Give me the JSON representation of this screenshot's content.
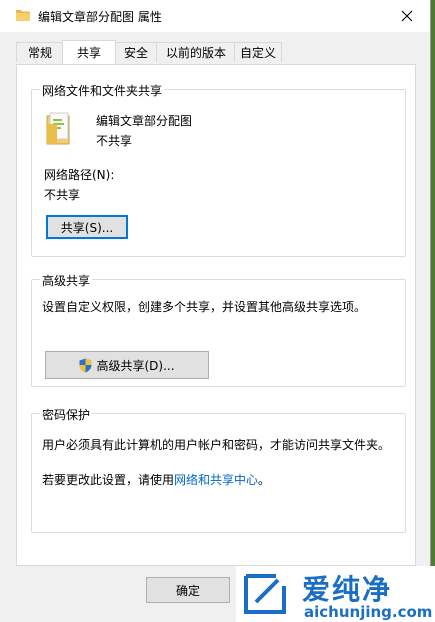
{
  "window": {
    "title": "编辑文章部分配图 属性"
  },
  "tabs": [
    {
      "label": "常规",
      "active": false
    },
    {
      "label": "共享",
      "active": true
    },
    {
      "label": "安全",
      "active": false
    },
    {
      "label": "以前的版本",
      "active": false
    },
    {
      "label": "自定义",
      "active": false
    }
  ],
  "network_sharing": {
    "group_title": "网络文件和文件夹共享",
    "folder_name": "编辑文章部分配图",
    "share_status": "不共享",
    "path_label": "网络路径(N):",
    "path_value": "不共享",
    "share_button": "共享(S)..."
  },
  "advanced_sharing": {
    "group_title": "高级共享",
    "description": "设置自定义权限，创建多个共享，并设置其他高级共享选项。",
    "button": "高级共享(D)..."
  },
  "password_protection": {
    "group_title": "密码保护",
    "description": "用户必须具有此计算机的用户帐户和密码，才能访问共享文件夹。",
    "change_prefix": "若要更改此设置，请使用",
    "change_link": "网络和共享中心",
    "change_suffix": "。"
  },
  "footer": {
    "ok_button": "确定"
  },
  "watermark": {
    "brand_cn": "爱纯净",
    "brand_url": "aichunjing.com"
  },
  "colors": {
    "link": "#0066cc",
    "focus": "#0078d7",
    "watermark": "#1a6fc4"
  }
}
